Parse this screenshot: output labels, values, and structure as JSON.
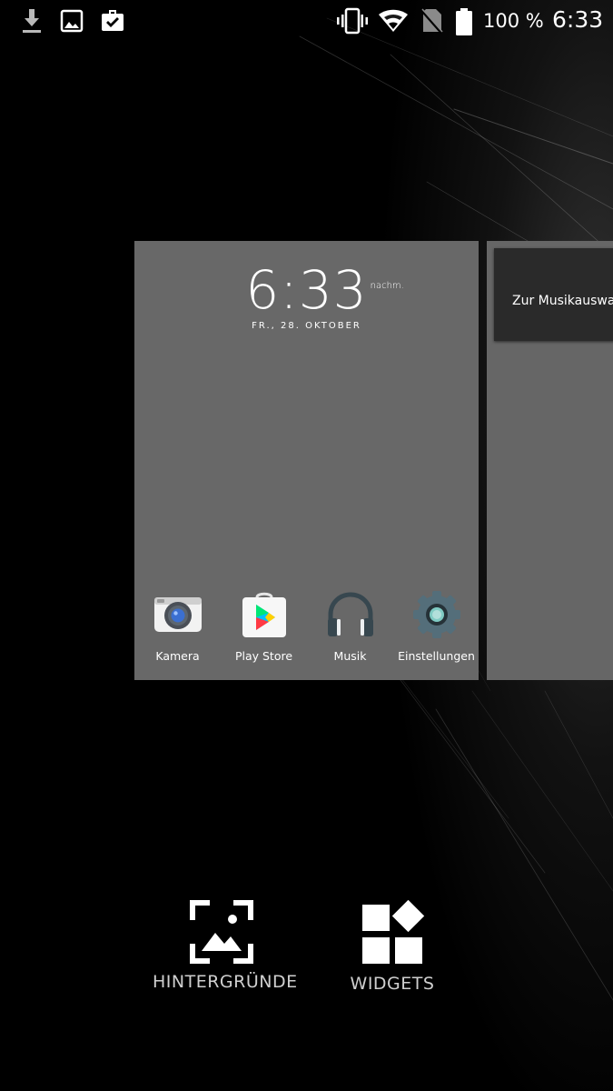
{
  "status_bar": {
    "notification_icons": [
      "download-icon",
      "image-icon",
      "briefcase-check-icon"
    ],
    "system_icons": [
      "vibrate-icon",
      "wifi-icon",
      "no-sim-icon",
      "battery-icon"
    ],
    "battery": "100 %",
    "time": "6:33"
  },
  "home_preview": {
    "clock": {
      "time": "6:33",
      "ampm": "nachm.",
      "date": "FR., 28. OKTOBER"
    },
    "apps": [
      {
        "label": "Kamera",
        "icon": "camera-icon"
      },
      {
        "label": "Play Store",
        "icon": "play-store-icon"
      },
      {
        "label": "Musik",
        "icon": "headphones-icon"
      },
      {
        "label": "Einstellungen",
        "icon": "settings-gear-icon"
      }
    ],
    "next_page": {
      "widget_text": "Zur Musikauswa"
    }
  },
  "actions": {
    "wallpapers_label": "HINTERGRÜNDE",
    "widgets_label": "WIDGETS"
  },
  "colors": {
    "panel": "#686868",
    "status_text": "#ffffff",
    "action_label": "#cfcfcf"
  }
}
